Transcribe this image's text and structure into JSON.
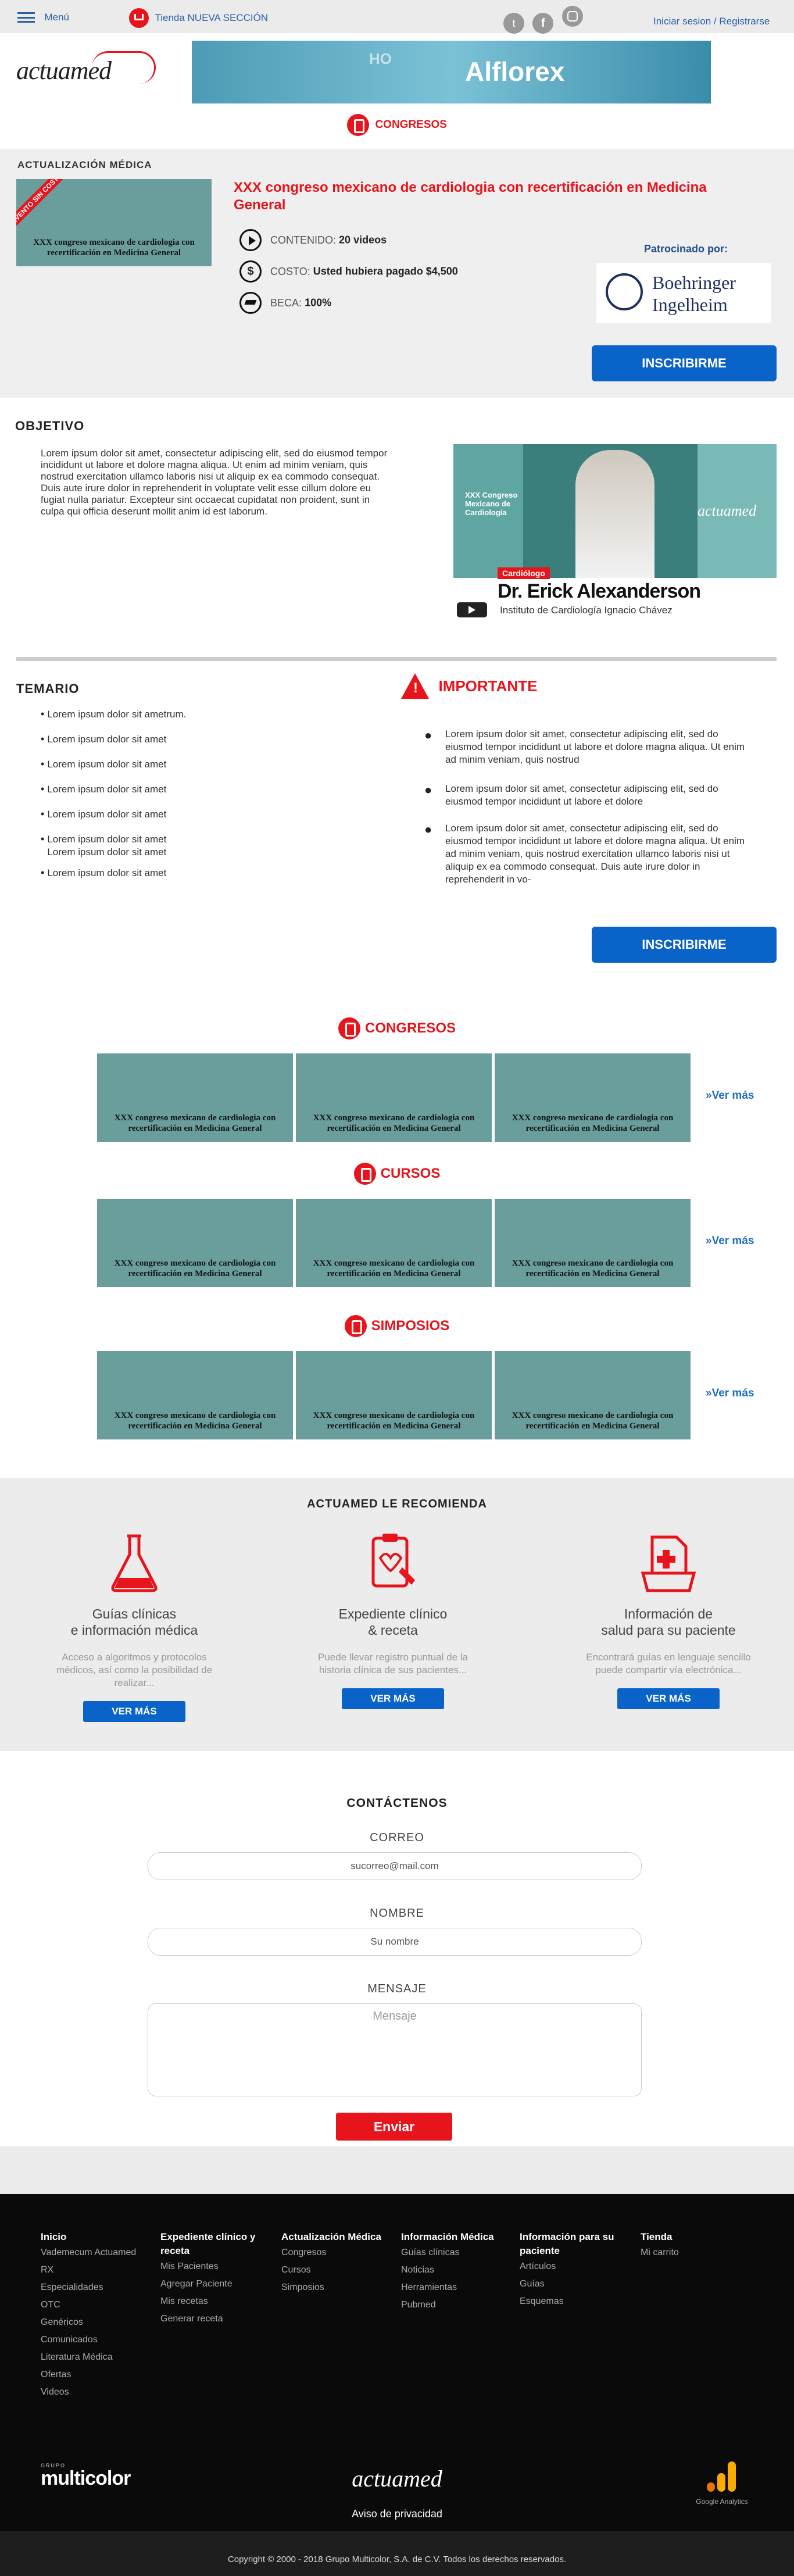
{
  "topbar": {
    "menu_label": "Menú",
    "store_label": "Tienda NUEVA SECCIÓN",
    "login_label": "Iniciar sesion / Registrarse",
    "social": [
      "twitter-icon",
      "facebook-icon",
      "instagram-icon"
    ]
  },
  "brand": {
    "logo_text": "actuamed",
    "banner_text": "Alflorex",
    "banner_prefix": "HO",
    "section_label": "CONGRESOS"
  },
  "course": {
    "category": "ACTUALIZACIÓN MÉDICA",
    "ribbon": "EVENTO SIN COSTO",
    "thumb_caption": "XXX congreso mexicano de cardiologia con recertificación en Medicina General",
    "title": "XXX congreso mexicano de cardiologia con recertificación en Medicina General",
    "content_label": "CONTENIDO:",
    "content_value": "20 videos",
    "cost_label": "COSTO:",
    "cost_value": "Usted hubiera pagado $4,500",
    "scholarship_label": "BECA:",
    "scholarship_value": "100%",
    "sponsor_label": "Patrocinado por:",
    "sponsor_name_1": "Boehringer",
    "sponsor_name_2": "Ingelheim",
    "enroll_label": "INSCRIBIRME"
  },
  "objective": {
    "heading": "OBJETIVO",
    "body": "Lorem ipsum dolor sit amet, consectetur adipiscing elit, sed do eiusmod tempor incididunt ut labore et dolore magna aliqua. Ut enim ad minim veniam, quis nostrud exercitation ullamco laboris nisi ut aliquip ex ea commodo consequat. Duis aute irure dolor in reprehenderit in voluptate velit esse cillum dolore eu fugiat nulla pariatur. Excepteur sint occaecat cupidatat non proident, sunt in culpa qui officia deserunt mollit anim id est laborum.",
    "video": {
      "badge": "XXX Congreso Mexicano de Cardiología",
      "logo": "actuamed",
      "role": "Cardiólogo",
      "name": "Dr. Erick Alexanderson",
      "institute": "Instituto de Cardiología Ignacio Chávez"
    }
  },
  "temario": {
    "heading": "TEMARIO",
    "items": [
      "Lorem ipsum dolor sit ametrum.",
      "Lorem ipsum dolor sit amet",
      "Lorem ipsum dolor sit amet",
      "Lorem ipsum dolor sit amet",
      "Lorem ipsum dolor sit amet",
      "Lorem ipsum dolor sit amet\nLorem ipsum dolor sit amet",
      "Lorem ipsum dolor sit amet"
    ]
  },
  "importante": {
    "heading": "IMPORTANTE",
    "items": [
      "Lorem ipsum dolor sit amet, consectetur adipiscing elit, sed do eiusmod tempor incididunt ut labore et dolore magna aliqua. Ut enim ad minim veniam, quis nostrud",
      "Lorem ipsum dolor sit amet, consectetur adipiscing elit, sed do eiusmod tempor incididunt ut labore et dolore",
      "Lorem ipsum dolor sit amet, consectetur adipiscing elit, sed do eiusmod tempor incididunt ut labore et dolore magna aliqua. Ut enim ad minim veniam, quis nostrud exercitation ullamco laboris nisi ut aliquip ex ea commodo consequat. Duis aute irure dolor in reprehenderit in vo-"
    ],
    "enroll_label": "INSCRIBIRME"
  },
  "carousels": {
    "see_more": "»Ver más",
    "thumb_caption": "XXX congreso mexicano de cardiologia con recertificación en Medicina General",
    "sections": [
      {
        "title": "CONGRESOS"
      },
      {
        "title": "CURSOS"
      },
      {
        "title": "SIMPOSIOS"
      }
    ]
  },
  "recommend": {
    "heading": "ACTUAMED LE RECOMIENDA",
    "button": "VER MÁS",
    "cards": [
      {
        "title": "Guías clínicas\ne información médica",
        "text": "Acceso a algoritmos y protocolos médicos, así como la posibilidad de realizar...",
        "icon": "flask-icon"
      },
      {
        "title": "Expediente clínico\n& receta",
        "text": "Puede llevar registro puntual de la historia clínica de sus pacientes...",
        "icon": "clipboard-icon"
      },
      {
        "title": "Información de\nsalud para su paciente",
        "text": "Encontrará guías en lenguaje sencillo puede compartir vía electrónica...",
        "icon": "medical-folder-icon"
      }
    ]
  },
  "contact": {
    "heading": "CONTÁCTENOS",
    "email_label": "CORREO",
    "email_value": "sucorreo@mail.com",
    "name_label": "NOMBRE",
    "name_placeholder": "Su nombre",
    "message_label": "MENSAJE",
    "message_placeholder": "Mensaje",
    "submit": "Enviar"
  },
  "footer": {
    "columns": [
      {
        "title": "Inicio",
        "links": [
          "Vademecum Actuamed",
          "RX",
          "Especialidades",
          "OTC",
          "Genéricos",
          "Comunicados",
          "Literatura Médica",
          "Ofertas",
          "Videos"
        ]
      },
      {
        "title": "Expediente clínico y receta",
        "links": [
          "Mis Pacientes",
          "Agregar Paciente",
          "Mis recetas",
          "Generar receta"
        ]
      },
      {
        "title": "Actualización Médica",
        "links": [
          "Congresos",
          "Cursos",
          "Simposios"
        ]
      },
      {
        "title": "Información Médica",
        "links": [
          "Guías clínicas",
          "Noticias",
          "Herramientas",
          "Pubmed"
        ]
      },
      {
        "title": "Información para su paciente",
        "links": [
          "Artículos",
          "Guías",
          "Esquemas"
        ]
      },
      {
        "title": "Tienda",
        "links": [
          "Mi carrito"
        ]
      }
    ],
    "group_small": "GRUPO",
    "group_logo": "multicolor",
    "center_logo": "actuamed",
    "privacy": "Aviso de privacidad",
    "analytics_label": "Google Analytics",
    "copyright": "Copyright © 2000 - 2018 Grupo Multicolor, S.A. de C.V. Todos los derechos reservados."
  },
  "colors": {
    "red": "#e8141c",
    "blue": "#0a63c9",
    "teal": "#6a9e9c",
    "dark": "#0a0a0a"
  }
}
